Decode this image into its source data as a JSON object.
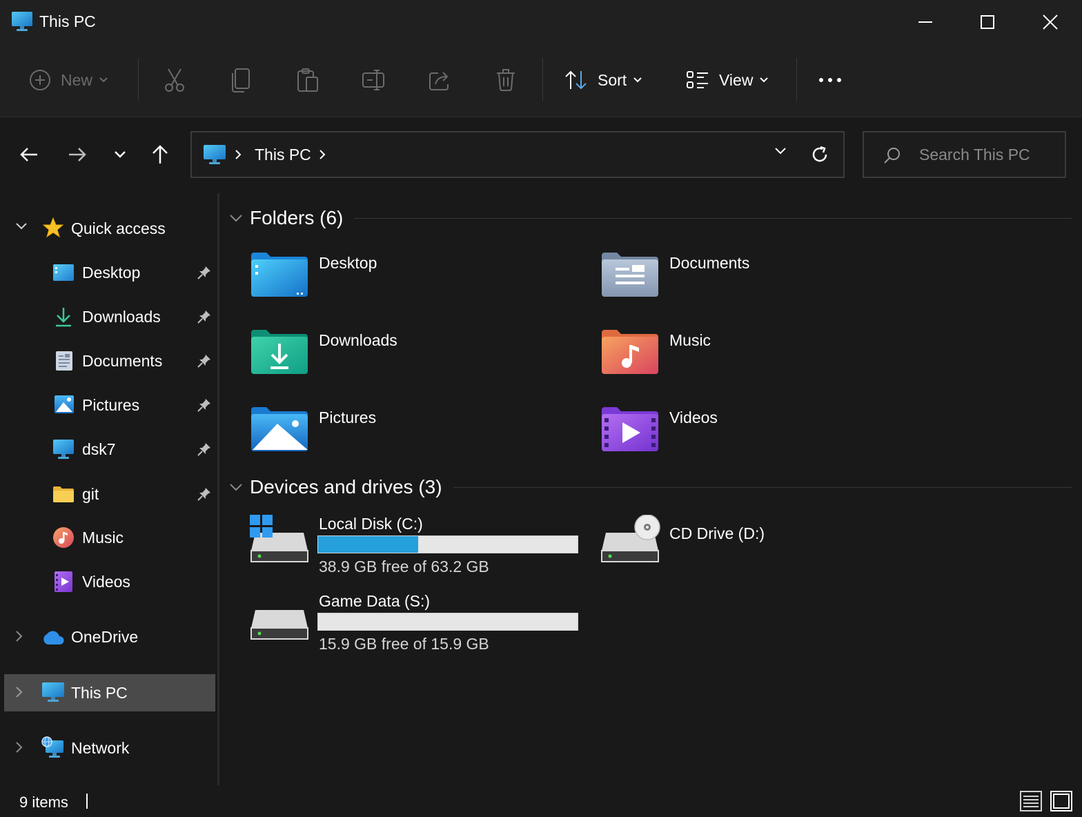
{
  "window": {
    "title": "This PC",
    "controls": [
      "minimize",
      "maximize",
      "close"
    ]
  },
  "toolbar": {
    "new_label": "New",
    "sort_label": "Sort",
    "view_label": "View",
    "icons": [
      "cut-icon",
      "copy-icon",
      "paste-icon",
      "rename-icon",
      "share-icon",
      "delete-icon",
      "more-icon"
    ]
  },
  "address": {
    "crumb": "This PC"
  },
  "search": {
    "placeholder": "Search This PC"
  },
  "sidebar": {
    "quick_access": "Quick access",
    "items": [
      {
        "label": "Desktop",
        "icon": "desktop-icon",
        "pinned": true
      },
      {
        "label": "Downloads",
        "icon": "downloads-icon",
        "pinned": true
      },
      {
        "label": "Documents",
        "icon": "documents-icon",
        "pinned": true
      },
      {
        "label": "Pictures",
        "icon": "pictures-icon",
        "pinned": true
      },
      {
        "label": "dsk7",
        "icon": "monitor-icon",
        "pinned": true
      },
      {
        "label": "git",
        "icon": "folder-icon",
        "pinned": true
      },
      {
        "label": "Music",
        "icon": "music-icon",
        "pinned": false
      },
      {
        "label": "Videos",
        "icon": "videos-icon",
        "pinned": false
      }
    ],
    "onedrive": "OneDrive",
    "this_pc": "This PC",
    "network": "Network"
  },
  "content": {
    "folders_header": "Folders (6)",
    "folders": [
      {
        "label": "Desktop",
        "icon": "desktop-folder-icon"
      },
      {
        "label": "Documents",
        "icon": "documents-folder-icon"
      },
      {
        "label": "Downloads",
        "icon": "downloads-folder-icon"
      },
      {
        "label": "Music",
        "icon": "music-folder-icon"
      },
      {
        "label": "Pictures",
        "icon": "pictures-folder-icon"
      },
      {
        "label": "Videos",
        "icon": "videos-folder-icon"
      }
    ],
    "drives_header": "Devices and drives (3)",
    "drives": [
      {
        "name": "Local Disk (C:)",
        "free": "38.9 GB free of 63.2 GB",
        "used_fraction": 0.385
      },
      {
        "name": "CD Drive (D:)"
      },
      {
        "name": "Game Data (S:)",
        "free": "15.9 GB free of 15.9 GB",
        "used_fraction": 0.0
      }
    ]
  },
  "status": {
    "items": "9 items"
  },
  "colors": {
    "accent": "#26a0da",
    "selection": "#4a4a4a",
    "background": "#191919",
    "chrome": "#202020"
  }
}
